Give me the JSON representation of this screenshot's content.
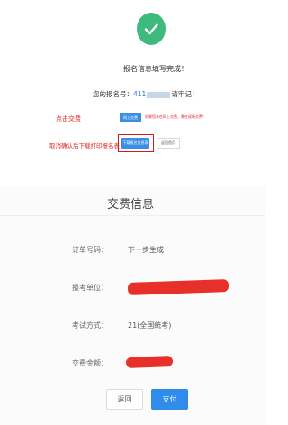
{
  "confirmation": {
    "complete_text": "报名信息填写完成！",
    "regno_prefix": "您的报名号：",
    "regno_visible": "411",
    "regno_suffix": "请牢记！"
  },
  "annotations": {
    "pay_hint": "点击交费",
    "download_hint": "取消确认后下载打印报名表"
  },
  "actions": {
    "pay_online_label": "网上交费",
    "pay_note": "如果您未在网上交费，需在现场交费！",
    "download_label": "下载报名信息表",
    "back_home_label": "返回首页"
  },
  "payment": {
    "title": "交费信息",
    "order_label": "订单号码：",
    "order_value": "下一步生成",
    "unit_label": "报考单位：",
    "method_label": "考试方式：",
    "method_value": "21(全国统考)",
    "amount_label": "交费金额："
  },
  "buttons": {
    "back": "返回",
    "submit": "支付"
  },
  "colors": {
    "success": "#3dba7c",
    "primary": "#2f8ceb",
    "annotation": "#e02424"
  }
}
